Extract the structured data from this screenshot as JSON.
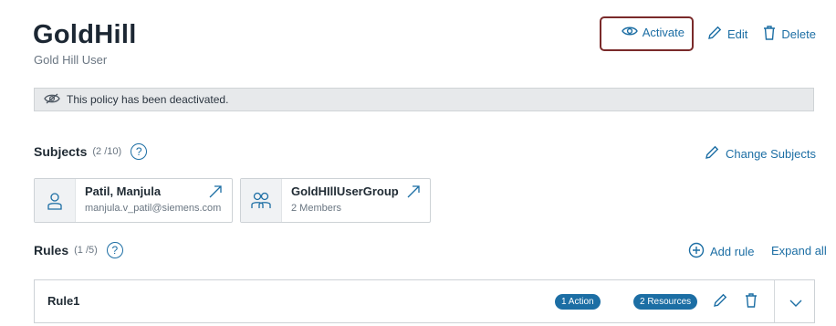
{
  "policy": {
    "title": "GoldHill",
    "subtitle": "Gold Hill User"
  },
  "actions": {
    "activate": "Activate",
    "edit": "Edit",
    "delete": "Delete"
  },
  "banner": {
    "message": "This policy has been deactivated."
  },
  "subjects": {
    "heading": "Subjects",
    "count": "(2 /10)",
    "help": "?",
    "change_label": "Change Subjects",
    "items": [
      {
        "name": "Patil, Manjula",
        "detail": "manjula.v_patil@siemens.com",
        "icon": "user-icon"
      },
      {
        "name": "GoldHIllUserGroup",
        "detail": "2 Members",
        "icon": "group-icon"
      }
    ]
  },
  "rules": {
    "heading": "Rules",
    "count": "(1 /5)",
    "help": "?",
    "add_label": "Add rule",
    "expand_label": "Expand all",
    "items": [
      {
        "name": "Rule1",
        "actions_badge": "1 Action",
        "resources_badge": "2 Resources"
      }
    ]
  },
  "colors": {
    "accent": "#1c6ea4",
    "highlight_border": "#7a2a2a",
    "banner_bg": "#e7e9eb"
  }
}
